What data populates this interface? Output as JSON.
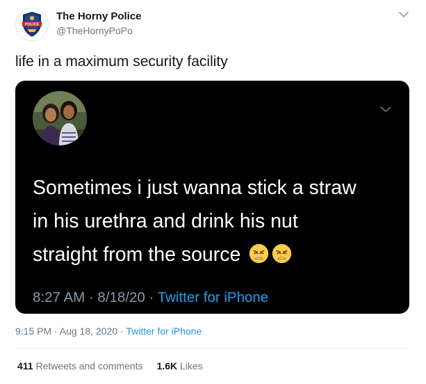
{
  "tweet": {
    "author": {
      "display_name": "The Horny Police",
      "handle": "@TheHornyPoPo",
      "avatar_badge_text": "POLICE"
    },
    "text": "life in a maximum security facility",
    "timestamp": "9:15 PM · Aug 18, 2020",
    "separator": " · ",
    "source": "Twitter for iPhone",
    "stats": {
      "retweets_count": "411",
      "retweets_label": "Retweets and comments",
      "likes_count": "1.6K",
      "likes_label": "Likes"
    }
  },
  "embedded": {
    "lines": [
      "Sometimes i just wanna stick a straw",
      "in his urethra and drink his nut",
      "straight from the source"
    ],
    "emojis": [
      "weary-face-emoji",
      "weary-face-emoji"
    ],
    "timestamp": "8:27 AM · 8/18/20",
    "separator": " · ",
    "source": "Twitter for iPhone",
    "colors": {
      "background": "#000000",
      "text": "#ffffff",
      "meta": "#8899a6",
      "link": "#1da1f2"
    }
  },
  "colors": {
    "link": "#1b95e0",
    "secondary_text": "#657786",
    "primary_text": "#14171a"
  }
}
